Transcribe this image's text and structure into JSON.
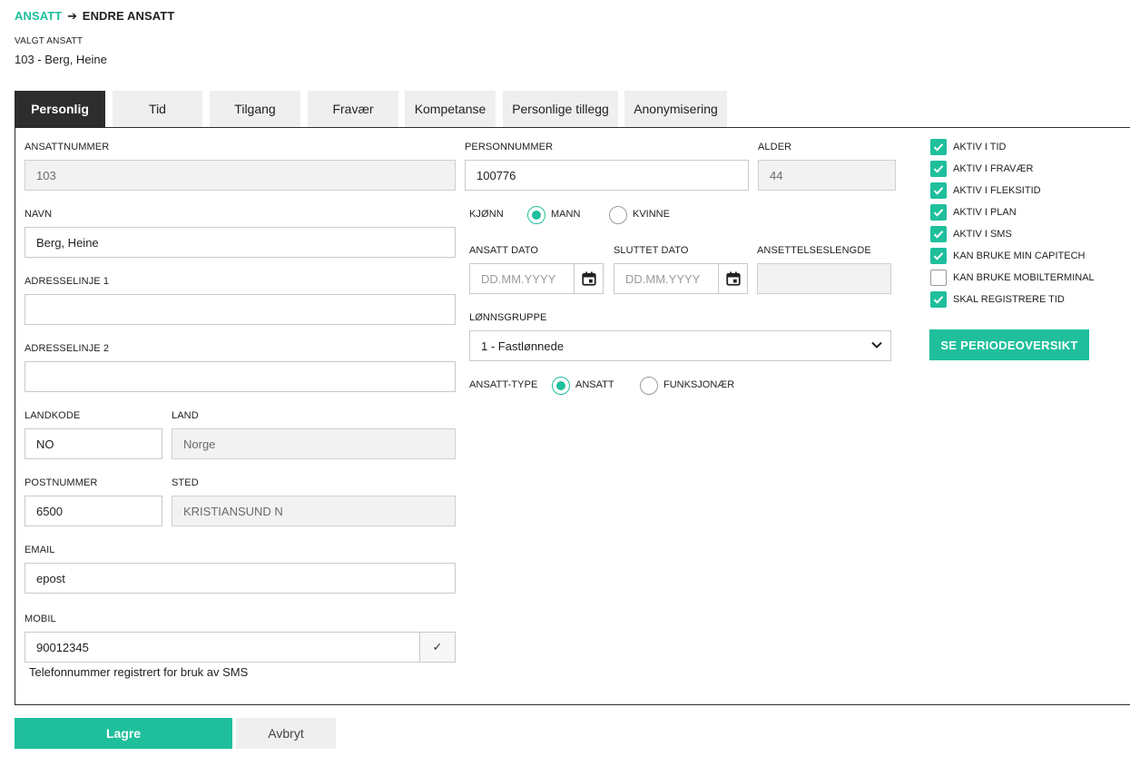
{
  "breadcrumb": {
    "root": "ANSATT",
    "arrow": "➔",
    "current": "ENDRE ANSATT"
  },
  "selected": {
    "label": "VALGT ANSATT",
    "value": "103 - Berg, Heine"
  },
  "tabs": [
    {
      "label": "Personlig"
    },
    {
      "label": "Tid"
    },
    {
      "label": "Tilgang"
    },
    {
      "label": "Fravær"
    },
    {
      "label": "Kompetanse"
    },
    {
      "label": "Personlige tillegg"
    },
    {
      "label": "Anonymisering"
    }
  ],
  "form": {
    "ansattnummer": {
      "label": "ANSATTNUMMER",
      "value": "103"
    },
    "navn": {
      "label": "NAVN",
      "value": "Berg, Heine"
    },
    "adresse1": {
      "label": "ADRESSELINJE 1",
      "value": ""
    },
    "adresse2": {
      "label": "ADRESSELINJE 2",
      "value": ""
    },
    "landkode": {
      "label": "LANDKODE",
      "value": "NO"
    },
    "land": {
      "label": "LAND",
      "value": "Norge"
    },
    "postnummer": {
      "label": "POSTNUMMER",
      "value": "6500"
    },
    "sted": {
      "label": "STED",
      "value": "KRISTIANSUND N"
    },
    "email": {
      "label": "EMAIL",
      "value": "epost"
    },
    "mobil": {
      "label": "MOBIL",
      "value": "90012345",
      "check": "✓",
      "hint": "Telefonnummer registrert for bruk av SMS"
    },
    "personnummer": {
      "label": "PERSONNUMMER",
      "value": "100776"
    },
    "alder": {
      "label": "ALDER",
      "value": "44"
    },
    "kjonn": {
      "label": "KJØNN",
      "options": [
        "MANN",
        "KVINNE"
      ],
      "selected": "MANN"
    },
    "ansatt_dato": {
      "label": "ANSATT DATO",
      "placeholder": "DD.MM.YYYY"
    },
    "sluttet_dato": {
      "label": "SLUTTET DATO",
      "placeholder": "DD.MM.YYYY"
    },
    "ansettelseslengde": {
      "label": "ANSETTELSESLENGDE",
      "value": ""
    },
    "lonnsgruppe": {
      "label": "LØNNSGRUPPE",
      "value": "1 - Fastlønnede"
    },
    "ansatt_type": {
      "label": "ANSATT-TYPE",
      "options": [
        "ANSATT",
        "FUNKSJONÆR"
      ],
      "selected": "ANSATT"
    }
  },
  "checkboxes": [
    {
      "label": "AKTIV I TID",
      "checked": true
    },
    {
      "label": "AKTIV I FRAVÆR",
      "checked": true
    },
    {
      "label": "AKTIV I FLEKSITID",
      "checked": true
    },
    {
      "label": "AKTIV I PLAN",
      "checked": true
    },
    {
      "label": "AKTIV I SMS",
      "checked": true
    },
    {
      "label": "KAN BRUKE MIN CAPITECH",
      "checked": true
    },
    {
      "label": "KAN BRUKE MOBILTERMINAL",
      "checked": false
    },
    {
      "label": "SKAL REGISTRERE TID",
      "checked": true
    }
  ],
  "periode_button": "SE PERIODEOVERSIKT",
  "footer": {
    "save": "Lagre",
    "cancel": "Avbryt"
  },
  "colors": {
    "accent": "#1fbf9c",
    "tab_active": "#2d2d2d",
    "tab_inactive": "#efefef"
  }
}
